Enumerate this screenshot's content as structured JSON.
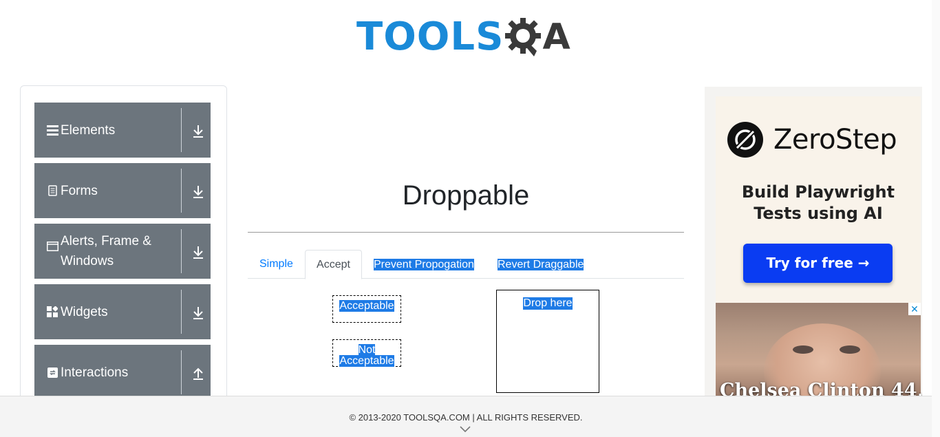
{
  "logo": {
    "text_blue": "TOOLS",
    "text_dark": "QA"
  },
  "sidebar": {
    "groups": [
      {
        "label": "Elements",
        "icon": "menu-icon",
        "arrow": "download-icon"
      },
      {
        "label": "Forms",
        "icon": "document-icon",
        "arrow": "download-icon"
      },
      {
        "label": "Alerts, Frame & Windows",
        "icon": "window-icon",
        "arrow": "download-icon"
      },
      {
        "label": "Widgets",
        "icon": "widgets-icon",
        "arrow": "download-icon"
      },
      {
        "label": "Interactions",
        "icon": "interactions-icon",
        "arrow": "upload-icon"
      }
    ]
  },
  "main": {
    "title": "Droppable",
    "tabs": [
      {
        "label": "Simple",
        "active": false
      },
      {
        "label": "Accept",
        "active": true
      },
      {
        "label": "Prevent Propogation",
        "active": false
      },
      {
        "label": "Revert Draggable",
        "active": false
      }
    ],
    "acceptable_label": "Acceptable",
    "not_acceptable_line1": "Not",
    "not_acceptable_line2": "Acceptable",
    "drop_label": "Drop here"
  },
  "ad": {
    "brand": "ZeroStep",
    "headline_line1": "Build Playwright",
    "headline_line2": "Tests using AI",
    "cta": "Try for free →",
    "close": "✕",
    "caption": "Chelsea Clinton 44,"
  },
  "footer": {
    "text": "© 2013-2020 TOOLSQA.COM | ALL RIGHTS RESERVED."
  },
  "colors": {
    "sidebar_bg": "#6c757d",
    "link": "#007bff",
    "selection": "#1e7be6",
    "cta": "#0a3cf2",
    "logo_blue": "#1a8ad8"
  }
}
